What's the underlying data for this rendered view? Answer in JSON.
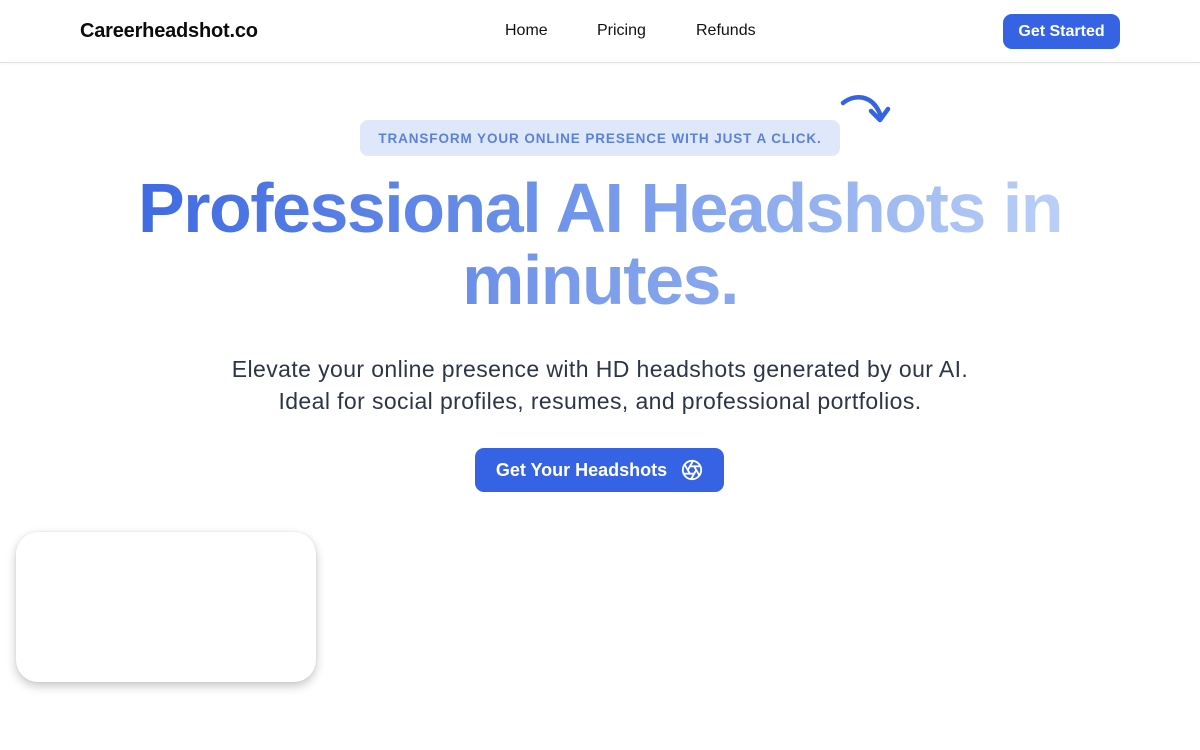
{
  "navbar": {
    "brand": "Careerheadshot.co",
    "links": [
      {
        "label": "Home"
      },
      {
        "label": "Pricing"
      },
      {
        "label": "Refunds"
      }
    ],
    "cta_label": "Get Started"
  },
  "hero": {
    "badge_text": "TRANSFORM YOUR ONLINE PRESENCE WITH JUST A CLICK.",
    "badge_arrow_icon": "curved-arrow-down-right-icon",
    "headline_line1": "Professional AI Headshots in",
    "headline_line2": "minutes.",
    "subtitle_line1": "Elevate your online presence with HD headshots generated by our AI.",
    "subtitle_line2": "Ideal for social profiles, resumes, and professional portfolios.",
    "cta_label": "Get Your Headshots",
    "cta_icon": "camera-aperture-icon"
  },
  "colors": {
    "primary": "#3563e4",
    "badge_bg": "#dfe8fb",
    "badge_text": "#5b82db",
    "headline_gradient_start": "#3f6ae2",
    "headline_gradient_end": "#bcd0f7",
    "body_text": "#2c3648"
  }
}
